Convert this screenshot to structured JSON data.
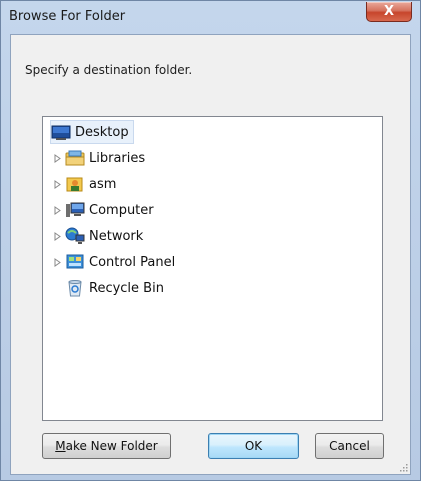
{
  "window": {
    "title": "Browse For Folder",
    "close_glyph": "X"
  },
  "instruction": "Specify a destination folder.",
  "tree": {
    "items": [
      {
        "label": "Desktop",
        "icon": "desktop-icon",
        "expandable": false,
        "selected": true
      },
      {
        "label": "Libraries",
        "icon": "libraries-icon",
        "expandable": true,
        "selected": false
      },
      {
        "label": "asm",
        "icon": "user-folder-icon",
        "expandable": true,
        "selected": false
      },
      {
        "label": "Computer",
        "icon": "computer-icon",
        "expandable": true,
        "selected": false
      },
      {
        "label": "Network",
        "icon": "network-icon",
        "expandable": true,
        "selected": false
      },
      {
        "label": "Control Panel",
        "icon": "control-panel-icon",
        "expandable": true,
        "selected": false
      },
      {
        "label": "Recycle Bin",
        "icon": "recycle-bin-icon",
        "expandable": false,
        "selected": false
      }
    ]
  },
  "buttons": {
    "make_new_folder_prefix": "M",
    "make_new_folder_rest": "ake New Folder",
    "ok": "OK",
    "cancel": "Cancel"
  },
  "colors": {
    "title_bar": "#c4d6ec",
    "close_button": "#c7452c",
    "client_bg": "#f0f0f0",
    "selection": "#e8f1fb",
    "default_button_border": "#3c7fb1"
  }
}
